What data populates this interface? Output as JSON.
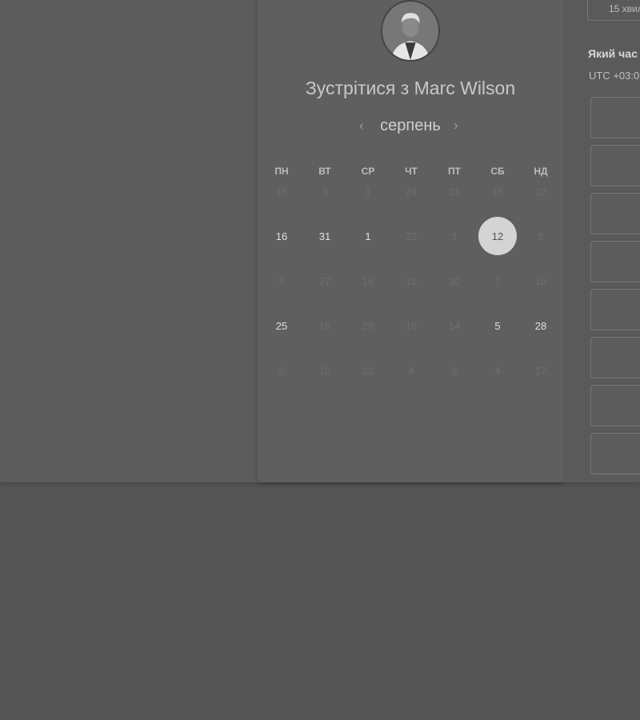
{
  "header": {
    "title": "Зустрітися з Marc Wilson"
  },
  "calendar": {
    "month": "серпень",
    "prev_arrow": "‹",
    "next_arrow": "›",
    "weekdays": [
      "ПН",
      "ВТ",
      "СР",
      "ЧТ",
      "ПТ",
      "СБ",
      "НД"
    ],
    "weeks": [
      [
        {
          "d": "18",
          "a": false
        },
        {
          "d": "3",
          "a": false
        },
        {
          "d": "1",
          "a": false
        },
        {
          "d": "24",
          "a": false
        },
        {
          "d": "21",
          "a": false
        },
        {
          "d": "18",
          "a": false
        },
        {
          "d": "12",
          "a": false
        }
      ],
      [
        {
          "d": "16",
          "a": true
        },
        {
          "d": "31",
          "a": true
        },
        {
          "d": "1",
          "a": true
        },
        {
          "d": "22",
          "a": false
        },
        {
          "d": "1",
          "a": false
        },
        {
          "d": "12",
          "a": true,
          "selected": true
        },
        {
          "d": "2",
          "a": false
        }
      ],
      [
        {
          "d": "5",
          "a": false
        },
        {
          "d": "27",
          "a": false
        },
        {
          "d": "18",
          "a": false
        },
        {
          "d": "18",
          "a": false
        },
        {
          "d": "30",
          "a": false
        },
        {
          "d": "7",
          "a": false
        },
        {
          "d": "16",
          "a": false
        }
      ],
      [
        {
          "d": "25",
          "a": true
        },
        {
          "d": "18",
          "a": false
        },
        {
          "d": "29",
          "a": false
        },
        {
          "d": "16",
          "a": false
        },
        {
          "d": "14",
          "a": false
        },
        {
          "d": "5",
          "a": true
        },
        {
          "d": "28",
          "a": true
        }
      ],
      [
        {
          "d": "6",
          "a": false
        },
        {
          "d": "19",
          "a": false
        },
        {
          "d": "22",
          "a": false
        },
        {
          "d": "4",
          "a": false
        },
        {
          "d": "9",
          "a": false
        },
        {
          "d": "4",
          "a": false
        },
        {
          "d": "17",
          "a": false
        }
      ]
    ]
  },
  "side": {
    "duration": "15 хвил",
    "question": "Який час",
    "timezone": "UTC +03:0"
  }
}
